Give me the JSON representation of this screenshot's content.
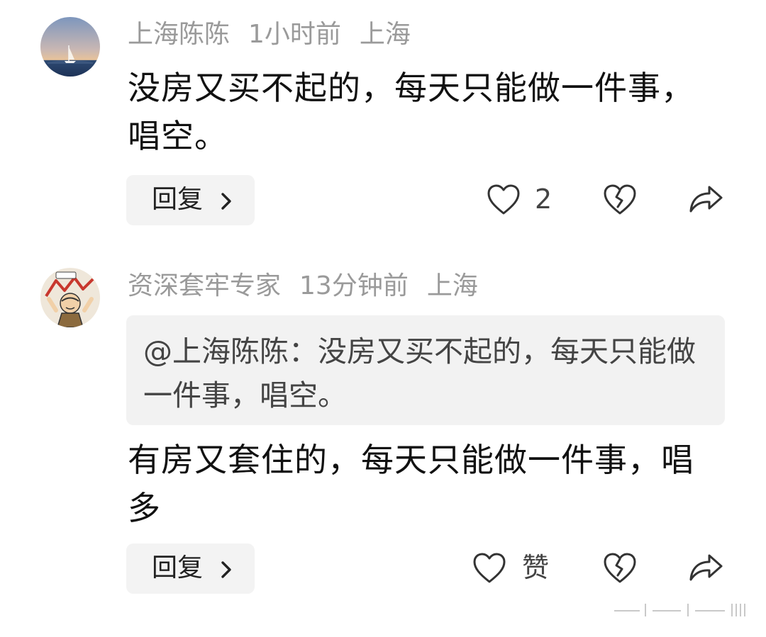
{
  "comments": [
    {
      "username": "上海陈陈",
      "time": "1小时前",
      "location": "上海",
      "text": "没房又买不起的，每天只能做一件事，唱空。",
      "reply_label": "回复",
      "like_count": "2",
      "icons": {
        "like": "heart-outline-icon",
        "dislike": "broken-heart-icon",
        "share": "share-arrow-icon",
        "reply_chevron": "chevron-right-icon"
      }
    },
    {
      "username": "资深套牢专家",
      "time": "13分钟前",
      "location": "上海",
      "quote": "@上海陈陈：没房又买不起的，每天只能做一件事，唱空。",
      "text": "有房又套住的，每天只能做一件事，唱多",
      "reply_label": "回复",
      "like_label": "赞",
      "icons": {
        "like": "heart-outline-icon",
        "dislike": "broken-heart-icon",
        "share": "share-arrow-icon",
        "reply_chevron": "chevron-right-icon"
      }
    }
  ],
  "colors": {
    "meta_text": "#9a9a9a",
    "body_text": "#111111",
    "quote_bg": "#f2f2f2",
    "button_bg": "#f3f3f3",
    "icon_stroke": "#333333"
  }
}
